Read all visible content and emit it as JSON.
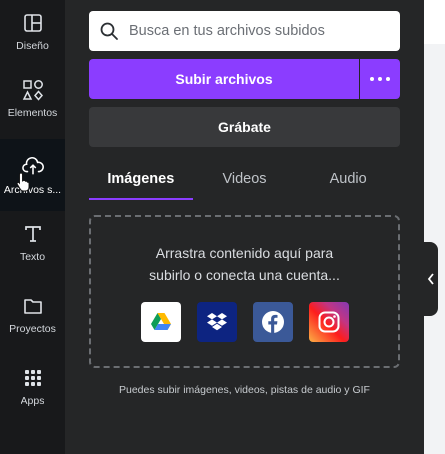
{
  "rail": {
    "items": [
      {
        "label": "Diseño",
        "icon": "layout-icon"
      },
      {
        "label": "Elementos",
        "icon": "shapes-icon"
      },
      {
        "label": "Archivos s...",
        "icon": "cloud-upload-icon"
      },
      {
        "label": "Texto",
        "icon": "text-icon"
      },
      {
        "label": "Proyectos",
        "icon": "folder-icon"
      },
      {
        "label": "Apps",
        "icon": "apps-grid-icon"
      }
    ],
    "active_index": 2
  },
  "search": {
    "placeholder": "Busca en tus archivos subidos",
    "value": ""
  },
  "upload": {
    "label": "Subir archivos",
    "more_icon": "ellipsis-icon"
  },
  "record": {
    "label": "Grábate"
  },
  "tabs": [
    {
      "label": "Imágenes",
      "active": true
    },
    {
      "label": "Videos",
      "active": false
    },
    {
      "label": "Audio",
      "active": false
    }
  ],
  "dropzone": {
    "line1": "Arrastra contenido aquí para",
    "line2": "subirlo o conecta una cuenta...",
    "sources": [
      {
        "name": "Google Drive",
        "icon": "google-drive-icon"
      },
      {
        "name": "Dropbox",
        "icon": "dropbox-icon"
      },
      {
        "name": "Facebook",
        "icon": "facebook-icon"
      },
      {
        "name": "Instagram",
        "icon": "instagram-icon"
      }
    ]
  },
  "hint": "Puedes subir imágenes, videos, pistas de audio y GIF",
  "colors": {
    "accent": "#8b3dff",
    "panel": "#252627",
    "rail": "#0e1318"
  }
}
